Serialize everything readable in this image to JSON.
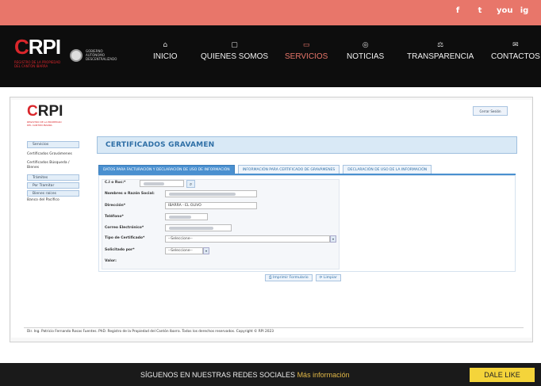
{
  "social": [
    "f",
    "t",
    "you",
    "ig"
  ],
  "brand": {
    "rpi": "RPI",
    "sub": "REGISTRO DE LA PROPIEDAD DEL CANTÓN IBARRA",
    "gov": "GOBIERNO AUTÓNOMO DESCENTRALIZADO"
  },
  "nav": [
    {
      "icon": "⌂",
      "label": "INICIO",
      "active": false
    },
    {
      "icon": "▢",
      "label": "QUIENES SOMOS",
      "active": false
    },
    {
      "icon": "▭",
      "label": "SERVICIOS",
      "active": true
    },
    {
      "icon": "◎",
      "label": "NOTICIAS",
      "active": false
    },
    {
      "icon": "⚖",
      "label": "TRANSPARENCIA",
      "active": false
    },
    {
      "icon": "✉",
      "label": "CONTACTOS",
      "active": false
    }
  ],
  "app": {
    "logo": "RPI",
    "logo_sub": "REGISTRO DE LA PROPIEDAD DEL CANTÓN IBARRA",
    "logout": "Cerrar Sesión"
  },
  "sidebar": {
    "servicios": "Servicios",
    "cert_grav": "Certificados Gravámenes",
    "cert_busq": "Certificados Búsqueda / Bienes",
    "tramites": "Trámites",
    "por_tramitar": "Por Tramitar",
    "bienes": "Bienes raíces",
    "banco": "Banco del Pacífico"
  },
  "page": {
    "title": "CERTIFICADOS GRAVAMEN",
    "tabs": [
      "DATOS PARA FACTURACIÓN Y DECLARACIÓN DE USO DE INFORMACIÓN",
      "INFORMACIÓN PARA CERTIFICADO DE GRAVÁMENES",
      "DECLARACIÓN DE USO DE LA INFORMACIÓN"
    ]
  },
  "form": {
    "ci_label": "C.I o Ruc:*",
    "nombres_label": "Nombres o Razón Social:",
    "direccion_label": "Dirección*",
    "direccion_value": "IBARRA - EL OLIVO",
    "telefono_label": "Teléfono*",
    "correo_label": "Correo Electrónico*",
    "tipo_label": "Tipo de Certificado*",
    "tipo_value": "--Seleccione--",
    "solicitado_label": "Solicitado por*",
    "solicitado_value": "--Seleccione--",
    "valor_label": "Valor:"
  },
  "actions": {
    "print": "⎙ Imprimir Formulario",
    "clear": "⟳ Limpiar"
  },
  "footer": {
    "copyright": "Dir. Ing. Patricio Fernando Rosas Fuentes. PhD. Registro de la Propiedad del Cantón Ibarra. Todos los derechos reservados. Copyright © RPI 2023",
    "follow": "SÍGUENOS EN NUESTRAS REDES SOCIALES",
    "more": "Más información",
    "like": "DALE LIKE"
  }
}
